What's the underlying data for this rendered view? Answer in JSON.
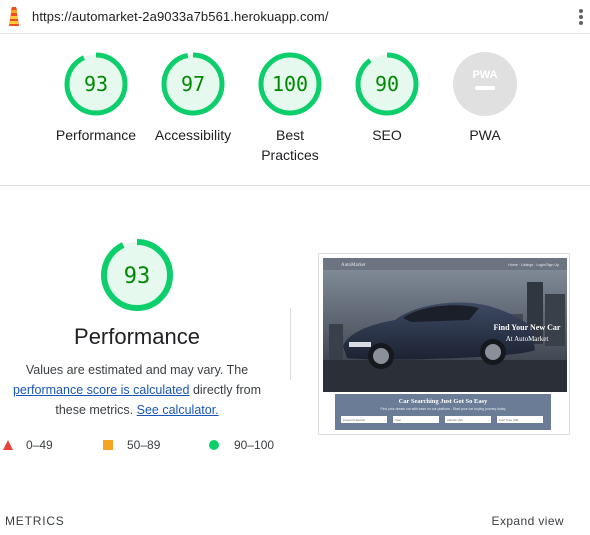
{
  "header": {
    "url": "https://automarket-2a9033a7b561.herokuapp.com/"
  },
  "categories": [
    {
      "label": "Performance",
      "score": "93"
    },
    {
      "label": "Accessibility",
      "score": "97"
    },
    {
      "label": "Best Practices",
      "score": "100"
    },
    {
      "label": "SEO",
      "score": "90"
    },
    {
      "label": "PWA",
      "score": "",
      "badge": "PWA"
    }
  ],
  "performance": {
    "score": "93",
    "title": "Performance",
    "desc_prefix": "Values are estimated and may vary. The",
    "desc_link1": "performance score is calculated",
    "desc_middle": "directly from these metrics.",
    "desc_link2": "See calculator."
  },
  "legend": [
    {
      "range": "0–49",
      "color": "#e8453c"
    },
    {
      "range": "50–89",
      "color": "#f4a623"
    },
    {
      "range": "90–100",
      "color": "#0cce6b"
    }
  ],
  "thumbnail": {
    "brand": "AutoMarket",
    "nav": "Home · Listings · Login/Sign Up",
    "hero_line1": "Find Your New Car",
    "hero_line2": "At AutoMarket",
    "panel_title": "Car Searching Just Got So Easy",
    "panel_sub": "Find your dream car with ease on our platform - Start your car buying journey today",
    "fields": [
      "Keyword Search",
      "Year",
      "Vehicle (All)",
      "Fuel Type (All)"
    ]
  },
  "colors": {
    "good": "#0cce6b",
    "good_fill": "#e5f9ee",
    "good_text": "#008800",
    "na": "#e0e0e0"
  },
  "footer": {
    "metrics_label": "METRICS",
    "expand_label": "Expand view"
  }
}
